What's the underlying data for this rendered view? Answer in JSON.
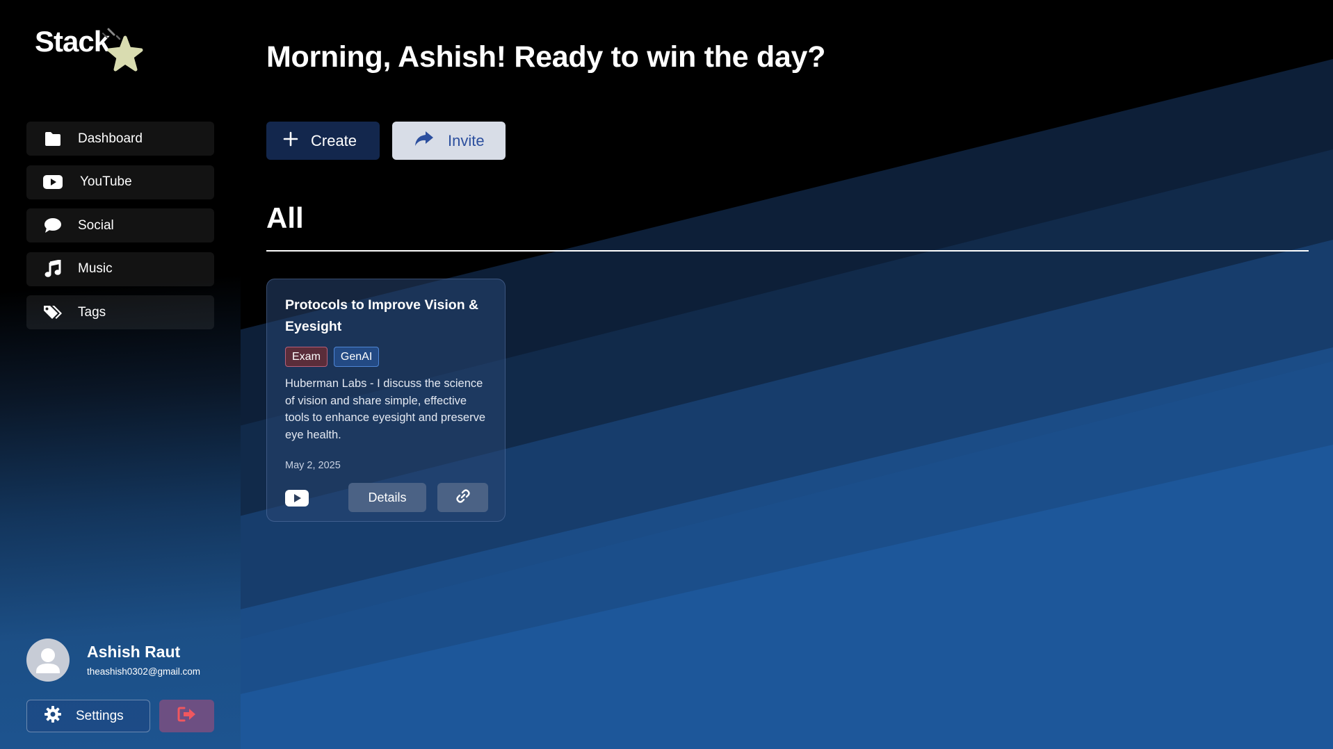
{
  "app": {
    "logo_text": "Stack"
  },
  "sidebar": {
    "items": [
      {
        "label": "Dashboard",
        "icon": "folder-icon"
      },
      {
        "label": "YouTube",
        "icon": "youtube-icon"
      },
      {
        "label": "Social",
        "icon": "chat-bubble-icon"
      },
      {
        "label": "Music",
        "icon": "music-note-icon"
      },
      {
        "label": "Tags",
        "icon": "tags-icon"
      }
    ],
    "profile": {
      "name": "Ashish Raut",
      "email": "theashish0302@gmail.com"
    },
    "settings_label": "Settings"
  },
  "main": {
    "greeting": "Morning, Ashish! Ready to win the day?",
    "create_label": "Create",
    "invite_label": "Invite",
    "section_title": "All",
    "cards": [
      {
        "title": "Protocols to Improve Vision & Eyesight",
        "tags": [
          "Exam",
          "GenAI"
        ],
        "description": "Huberman Labs - I discuss the science of vision and share simple, effective tools to enhance eyesight and preserve eye health.",
        "date": "May 2, 2025",
        "source_icon": "youtube-icon",
        "details_label": "Details"
      }
    ]
  },
  "colors": {
    "sidebar_item_bg": "#1a1a1a",
    "create_button": "#13274d",
    "invite_button": "#d8dde7",
    "invite_text": "#2c4f9e",
    "logout_button": "#6d4f82",
    "logout_icon": "#f0575f",
    "tag_exam": "#5a2d3a",
    "tag_genai": "#234a84",
    "star": "#d9dcb0"
  }
}
